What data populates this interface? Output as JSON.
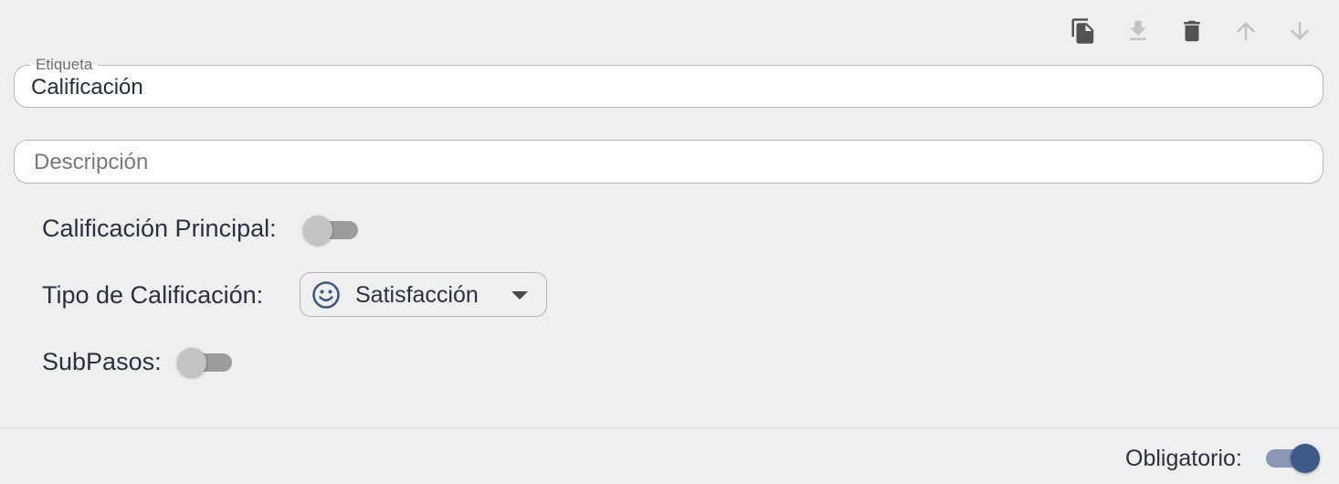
{
  "toolbar": {
    "icons": [
      "copy-icon",
      "download-icon",
      "trash-icon",
      "arrow-up-icon",
      "arrow-down-icon"
    ],
    "colors": {
      "active": "#525252",
      "disabled": "#c3c3c3"
    }
  },
  "form": {
    "label_field": {
      "label": "Etiqueta",
      "value": "Calificación"
    },
    "description_field": {
      "placeholder": "Descripción",
      "value": ""
    },
    "main_rating": {
      "label": "Calificación Principal:",
      "enabled": false
    },
    "rating_type": {
      "label": "Tipo de Calificación:",
      "selected": "Satisfacción",
      "icon": "smiley-icon"
    },
    "substeps": {
      "label": "SubPasos:",
      "enabled": false
    }
  },
  "footer": {
    "required": {
      "label": "Obligatorio:",
      "enabled": true
    }
  },
  "colors": {
    "accent": "#3d5a88",
    "text": "#2b3140",
    "background": "#efefef"
  }
}
